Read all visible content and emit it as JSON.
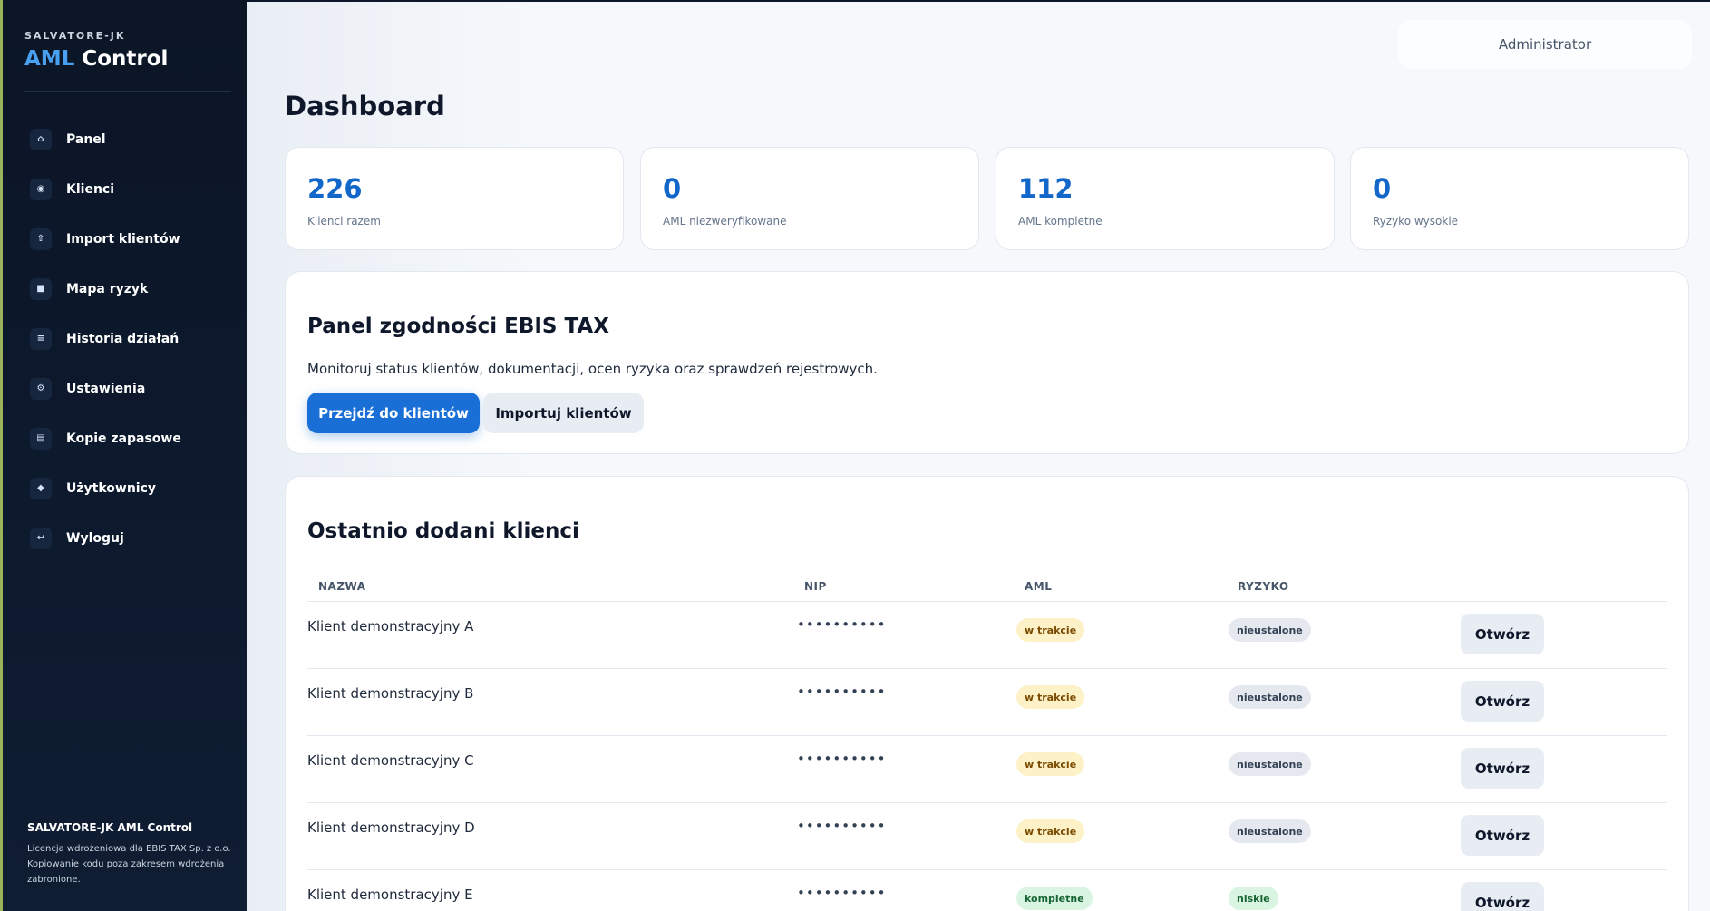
{
  "brand": {
    "subtitle": "SALVATORE-JK",
    "title_accent": "AML",
    "title_rest": "Control"
  },
  "nav": [
    {
      "icon": "home-icon",
      "glyph": "⌂",
      "label": "Panel"
    },
    {
      "icon": "users-icon",
      "glyph": "◉",
      "label": "Klienci"
    },
    {
      "icon": "upload-icon",
      "glyph": "⇧",
      "label": "Import klientów"
    },
    {
      "icon": "map-icon",
      "glyph": "■",
      "label": "Mapa ryzyk"
    },
    {
      "icon": "history-icon",
      "glyph": "≡",
      "label": "Historia działań"
    },
    {
      "icon": "gear-icon",
      "glyph": "⚙",
      "label": "Ustawienia"
    },
    {
      "icon": "backup-icon",
      "glyph": "▤",
      "label": "Kopie zapasowe"
    },
    {
      "icon": "user-icon",
      "glyph": "◆",
      "label": "Użytkownicy"
    },
    {
      "icon": "logout-icon",
      "glyph": "↩",
      "label": "Wyloguj"
    }
  ],
  "sidebar_footer": {
    "title": "SALVATORE-JK AML Control",
    "line1": "Licencja wdrożeniowa dla EBIS TAX Sp. z o.o.",
    "line2": "Kopiowanie kodu poza zakresem wdrożenia",
    "line3": "zabronione."
  },
  "header": {
    "user": "Administrator",
    "page_title": "Dashboard"
  },
  "stats": [
    {
      "value": "226",
      "label": "Klienci razem"
    },
    {
      "value": "0",
      "label": "AML niezweryfikowane"
    },
    {
      "value": "112",
      "label": "AML kompletne"
    },
    {
      "value": "0",
      "label": "Ryzyko wysokie"
    }
  ],
  "compliance": {
    "title": "Panel zgodności EBIS TAX",
    "description": "Monitoruj status klientów, dokumentacji, ocen ryzyka oraz sprawdzeń rejestrowych.",
    "primary_button": "Przejdź do klientów",
    "secondary_button": "Importuj klientów"
  },
  "recent": {
    "title": "Ostatnio dodani klienci",
    "columns": {
      "name": "NAZWA",
      "nip": "NIP",
      "aml": "AML",
      "risk": "RYZYKO"
    },
    "open_label": "Otwórz",
    "rows": [
      {
        "name": "Klient demonstracyjny A",
        "nip": "••••••••••",
        "aml": "w trakcie",
        "risk": "nieustalone"
      },
      {
        "name": "Klient demonstracyjny B",
        "nip": "••••••••••",
        "aml": "w trakcie",
        "risk": "nieustalone"
      },
      {
        "name": "Klient demonstracyjny C",
        "nip": "••••••••••",
        "aml": "w trakcie",
        "risk": "nieustalone"
      },
      {
        "name": "Klient demonstracyjny D",
        "nip": "••••••••••",
        "aml": "w trakcie",
        "risk": "nieustalone"
      },
      {
        "name": "Klient demonstracyjny E",
        "nip": "••••••••••",
        "aml": "kompletne",
        "risk": "niskie"
      }
    ]
  },
  "colors": {
    "accent": "#1a6fd6",
    "brand_accent": "#4aa0f0",
    "sidebar": "#0b1526"
  }
}
